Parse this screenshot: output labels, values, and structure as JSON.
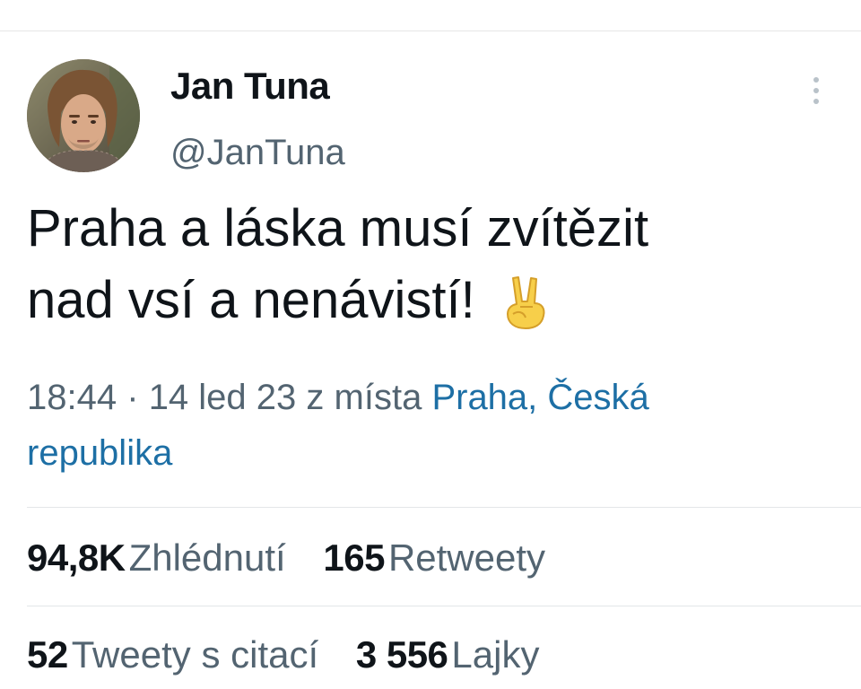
{
  "author": {
    "display_name": "Jan Tuna",
    "handle": "@JanTuna"
  },
  "tweet": {
    "text_line1": "Praha a láska musí zvítězit",
    "text_line2": "nad vsí a nenávistí!",
    "emoji_icon": "victory-hand-emoji",
    "time": "18:44",
    "separator": "·",
    "date": "14 led 23",
    "location_prefix": "z místa",
    "location_part1": "Praha, Česká",
    "location_part2": "republika"
  },
  "stats": {
    "views_count": "94,8K",
    "views_label": "Zhlédnutí",
    "retweets_count": "165",
    "retweets_label": "Retweety",
    "quotes_count": "52",
    "quotes_label": "Tweety s citací",
    "likes_count": "3 556",
    "likes_label": "Lajky"
  },
  "colors": {
    "text_primary": "#0f1419",
    "text_secondary": "#536471",
    "link": "#1d6fa5",
    "divider": "#e3e6e8",
    "background": "#ffffff"
  }
}
